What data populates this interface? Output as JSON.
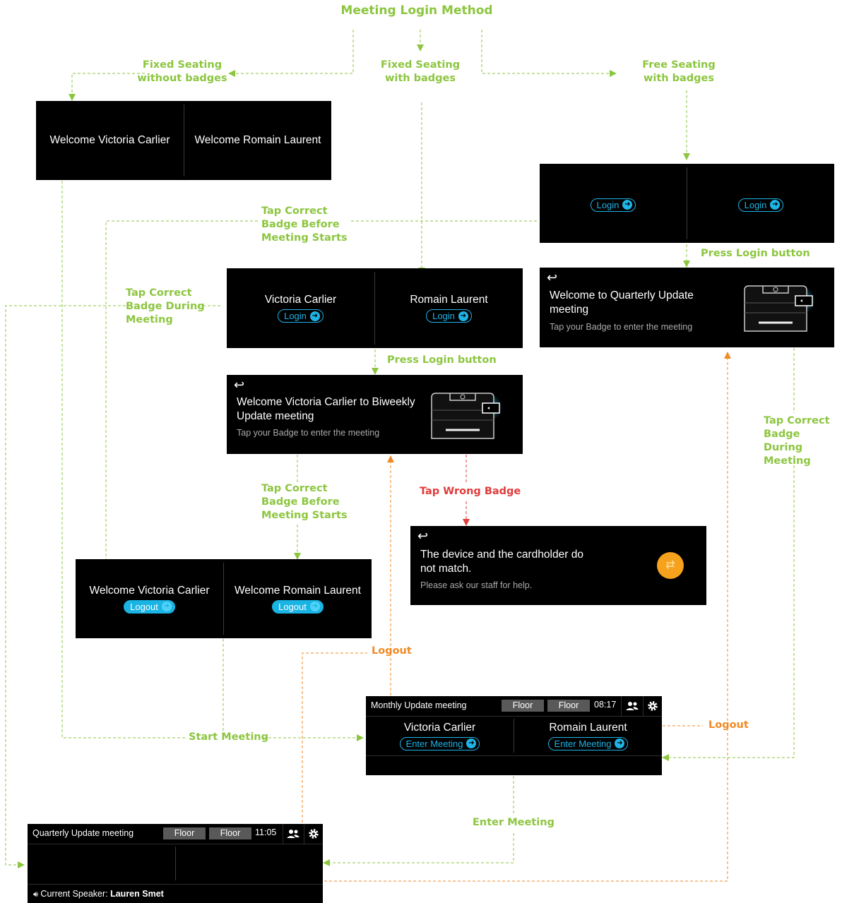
{
  "title": "Meeting Login Method",
  "colors": {
    "flow": "#8cc63f",
    "logout": "#f08a24",
    "wrong": "#e23b3b",
    "accent": "#1eb4e6"
  },
  "labels": {
    "fixed_no_badge": "Fixed Seating\nwithout badges",
    "fixed_badge": "Fixed Seating\nwith badges",
    "free_badge": "Free Seating\nwith badges",
    "tap_before_1": "Tap Correct\nBadge Before\nMeeting Starts",
    "tap_during_1": "Tap Correct\nBadge During\nMeeting",
    "press_login_1": "Press Login button",
    "press_login_2": "Press Login button",
    "tap_during_2": "Tap Correct\nBadge During\nMeeting",
    "tap_wrong": "Tap Wrong Badge",
    "tap_before_2": "Tap Correct\nBadge Before\nMeeting Starts",
    "logout_1": "Logout",
    "logout_2": "Logout",
    "start_meeting": "Start Meeting",
    "enter_meeting": "Enter Meeting"
  },
  "screen_welcome": {
    "left": "Welcome Victoria Carlier",
    "right": "Welcome Romain Laurent"
  },
  "screen_free_login": {
    "left_button": "Login",
    "right_button": "Login"
  },
  "screen_fixed_login": {
    "left_name": "Victoria Carlier",
    "right_name": "Romain Laurent",
    "left_button": "Login",
    "right_button": "Login"
  },
  "screen_badge_fixed": {
    "back": "↩",
    "title": "Welcome Victoria Carlier to Biweekly Update meeting",
    "subtitle": "Tap your Badge to enter the meeting"
  },
  "screen_badge_free": {
    "back": "↩",
    "title": "Welcome to Quarterly Update meeting",
    "subtitle": "Tap your Badge to enter the meeting"
  },
  "screen_mismatch": {
    "back": "↩",
    "title": "The device and the cardholder do not match.",
    "subtitle": "Please ask our staff for help."
  },
  "screen_logged_in": {
    "left_name": "Welcome Victoria Carlier",
    "right_name": "Welcome Romain Laurent",
    "left_button": "Logout",
    "right_button": "Logout"
  },
  "screen_monthly": {
    "meeting": "Monthly Update meeting",
    "floor1": "Floor",
    "floor2": "Floor",
    "time": "08:17",
    "left_name": "Victoria Carlier",
    "right_name": "Romain Laurent",
    "left_button": "Enter Meeting",
    "right_button": "Enter Meeting"
  },
  "screen_quarterly": {
    "meeting": "Quarterly Update meeting",
    "floor1": "Floor",
    "floor2": "Floor",
    "time": "11:05",
    "speaker_label": "Current Speaker:",
    "speaker_name": "Lauren Smet"
  }
}
